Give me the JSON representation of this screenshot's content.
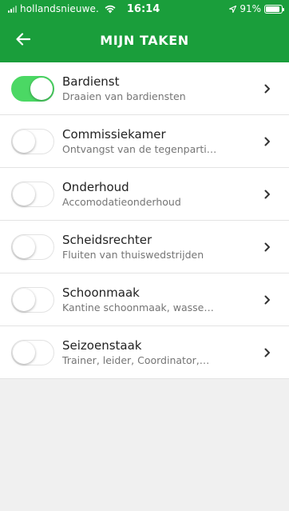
{
  "status_bar": {
    "carrier": "hollandsnieuwe.",
    "time": "16:14",
    "battery": "91%"
  },
  "header": {
    "title": "MIJN TAKEN"
  },
  "colors": {
    "header_bg": "#1a9e3b",
    "toggle_on": "#4bd864"
  },
  "tasks": [
    {
      "title": "Bardienst",
      "subtitle": "Draaien van bardiensten",
      "enabled": true
    },
    {
      "title": "Commissiekamer",
      "subtitle": "Ontvangst van de tegenparti…",
      "enabled": false
    },
    {
      "title": "Onderhoud",
      "subtitle": "Accomodatieonderhoud",
      "enabled": false
    },
    {
      "title": "Scheidsrechter",
      "subtitle": "Fluiten van thuiswedstrijden",
      "enabled": false
    },
    {
      "title": "Schoonmaak",
      "subtitle": "Kantine schoonmaak, wasse…",
      "enabled": false
    },
    {
      "title": "Seizoenstaak",
      "subtitle": "Trainer, leider, Coordinator,…",
      "enabled": false
    }
  ]
}
